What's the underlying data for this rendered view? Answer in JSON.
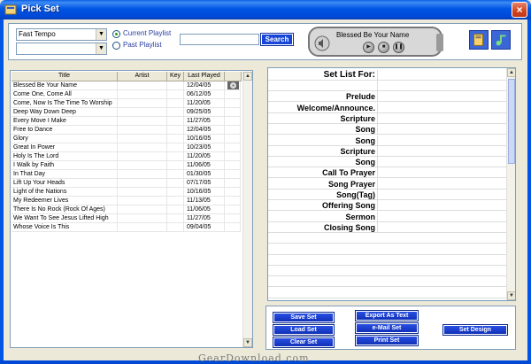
{
  "window": {
    "title": "Pick Set",
    "close_symbol": "×"
  },
  "filter": {
    "tempo_value": "Fast Tempo",
    "second_value": "",
    "playlist_options": [
      {
        "label": "Current Playlist",
        "selected": true
      },
      {
        "label": "Past Playlist",
        "selected": false
      }
    ],
    "search_value": "",
    "search_label": "Search"
  },
  "player": {
    "now_playing": "Blessed Be Your Name",
    "play_symbol": "▶",
    "stop_symbol": "■",
    "pause_symbol": "❚❚"
  },
  "song_list": {
    "columns": [
      "Title",
      "Artist",
      "Key",
      "Last Played"
    ],
    "rows": [
      {
        "title": "Blessed Be Your Name",
        "artist": "",
        "key": "",
        "last_played": "12/04/05"
      },
      {
        "title": "Come One, Come All",
        "artist": "",
        "key": "",
        "last_played": "06/12/05"
      },
      {
        "title": "Come, Now Is The Time To Worship",
        "artist": "",
        "key": "",
        "last_played": "11/20/05"
      },
      {
        "title": "Deep Way Down Deep",
        "artist": "",
        "key": "",
        "last_played": "09/25/05"
      },
      {
        "title": "Every Move I Make",
        "artist": "",
        "key": "",
        "last_played": "11/27/05"
      },
      {
        "title": "Free to Dance",
        "artist": "",
        "key": "",
        "last_played": "12/04/05"
      },
      {
        "title": "Glory",
        "artist": "",
        "key": "",
        "last_played": "10/16/05"
      },
      {
        "title": "Great In Power",
        "artist": "",
        "key": "",
        "last_played": "10/23/05"
      },
      {
        "title": "Holy Is The Lord",
        "artist": "",
        "key": "",
        "last_played": "11/20/05"
      },
      {
        "title": "I Walk by Faith",
        "artist": "",
        "key": "",
        "last_played": "11/06/05"
      },
      {
        "title": "In That Day",
        "artist": "",
        "key": "",
        "last_played": "01/30/05"
      },
      {
        "title": "Lift Up Your Heads",
        "artist": "",
        "key": "",
        "last_played": "07/17/05"
      },
      {
        "title": "Light of the Nations",
        "artist": "",
        "key": "",
        "last_played": "10/16/05"
      },
      {
        "title": "My Redeemer Lives",
        "artist": "",
        "key": "",
        "last_played": "11/13/05"
      },
      {
        "title": "There Is No Rock (Rock Of Ages)",
        "artist": "",
        "key": "",
        "last_played": "11/06/05"
      },
      {
        "title": "We Want To See Jesus Lifted High",
        "artist": "",
        "key": "",
        "last_played": "11/27/05"
      },
      {
        "title": "Whose Voice Is This",
        "artist": "",
        "key": "",
        "last_played": "09/04/05"
      }
    ]
  },
  "set_list": {
    "header": "Set List For:",
    "items": [
      "",
      "Prelude",
      "Welcome/Announce.",
      "Scripture",
      "Song",
      "Song",
      "Scripture",
      "Song",
      "Call To Prayer",
      "Song Prayer",
      "Song(Tag)",
      "Offering Song",
      "Sermon",
      "Closing Song"
    ]
  },
  "actions": {
    "save": "Save Set",
    "load": "Load Set",
    "clear": "Clear Set",
    "export": "Export As Text",
    "email": "e-Mail Set",
    "print": "Print Set",
    "design": "Set Design"
  },
  "watermark": "GearDownload.com",
  "colors": {
    "titlebar": "#0055e5",
    "button": "#1646d8",
    "window_bg": "#ece9d8"
  }
}
